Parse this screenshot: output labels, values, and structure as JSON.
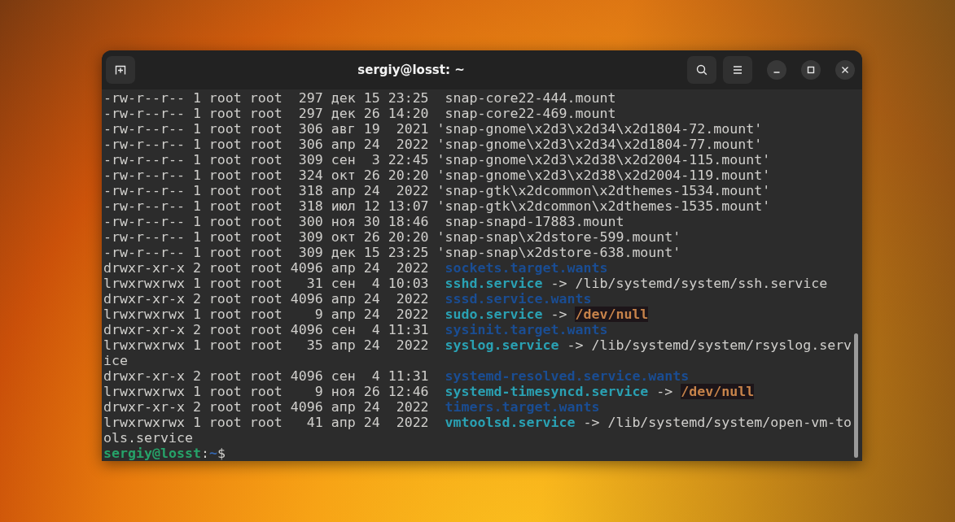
{
  "window": {
    "title": "sergiy@losst: ~"
  },
  "terminal": {
    "lines": [
      {
        "kind": "listing",
        "segments": [
          {
            "kind": "text",
            "text": "-rw-r--r-- 1 root root  297 дек 15 23:25"
          },
          {
            "kind": "text",
            "text": " snap-core22-444.mount"
          }
        ]
      },
      {
        "kind": "listing",
        "segments": [
          {
            "kind": "text",
            "text": "-rw-r--r-- 1 root root  297 дек 26 14:20"
          },
          {
            "kind": "text",
            "text": " snap-core22-469.mount"
          }
        ]
      },
      {
        "kind": "listing",
        "segments": [
          {
            "kind": "text",
            "text": "-rw-r--r-- 1 root root  306 авг 19  2021"
          },
          {
            "kind": "text",
            "text": "'snap-gnome\\x2d3\\x2d34\\x2d1804-72.mount'"
          }
        ]
      },
      {
        "kind": "listing",
        "segments": [
          {
            "kind": "text",
            "text": "-rw-r--r-- 1 root root  306 апр 24  2022"
          },
          {
            "kind": "text",
            "text": "'snap-gnome\\x2d3\\x2d34\\x2d1804-77.mount'"
          }
        ]
      },
      {
        "kind": "listing",
        "segments": [
          {
            "kind": "text",
            "text": "-rw-r--r-- 1 root root  309 сен  3 22:45"
          },
          {
            "kind": "text",
            "text": "'snap-gnome\\x2d3\\x2d38\\x2d2004-115.mount'"
          }
        ]
      },
      {
        "kind": "listing",
        "segments": [
          {
            "kind": "text",
            "text": "-rw-r--r-- 1 root root  324 окт 26 20:20"
          },
          {
            "kind": "text",
            "text": "'snap-gnome\\x2d3\\x2d38\\x2d2004-119.mount'"
          }
        ]
      },
      {
        "kind": "listing",
        "segments": [
          {
            "kind": "text",
            "text": "-rw-r--r-- 1 root root  318 апр 24  2022"
          },
          {
            "kind": "text",
            "text": "'snap-gtk\\x2dcommon\\x2dthemes-1534.mount'"
          }
        ]
      },
      {
        "kind": "listing",
        "segments": [
          {
            "kind": "text",
            "text": "-rw-r--r-- 1 root root  318 июл 12 13:07"
          },
          {
            "kind": "text",
            "text": "'snap-gtk\\x2dcommon\\x2dthemes-1535.mount'"
          }
        ]
      },
      {
        "kind": "listing",
        "segments": [
          {
            "kind": "text",
            "text": "-rw-r--r-- 1 root root  300 ноя 30 18:46"
          },
          {
            "kind": "text",
            "text": " snap-snapd-17883.mount"
          }
        ]
      },
      {
        "kind": "listing",
        "segments": [
          {
            "kind": "text",
            "text": "-rw-r--r-- 1 root root  309 окт 26 20:20"
          },
          {
            "kind": "text",
            "text": "'snap-snap\\x2dstore-599.mount'"
          }
        ]
      },
      {
        "kind": "listing",
        "segments": [
          {
            "kind": "text",
            "text": "-rw-r--r-- 1 root root  309 дек 15 23:25"
          },
          {
            "kind": "text",
            "text": "'snap-snap\\x2dstore-638.mount'"
          }
        ]
      },
      {
        "kind": "listing",
        "segments": [
          {
            "kind": "text",
            "text": "drwxr-xr-x 2 root root 4096 апр 24  2022"
          },
          {
            "kind": "dir",
            "text": " sockets.target.wants"
          }
        ]
      },
      {
        "kind": "listing",
        "segments": [
          {
            "kind": "text",
            "text": "lrwxrwxrwx 1 root root   31 сен  4 10:03"
          },
          {
            "kind": "link",
            "text": " sshd.service"
          },
          {
            "kind": "text",
            "text": "->"
          },
          {
            "kind": "text",
            "text": "/lib/systemd/system/ssh.service"
          }
        ]
      },
      {
        "kind": "listing",
        "segments": [
          {
            "kind": "text",
            "text": "drwxr-xr-x 2 root root 4096 апр 24  2022"
          },
          {
            "kind": "dir",
            "text": " sssd.service.wants"
          }
        ]
      },
      {
        "kind": "listing",
        "segments": [
          {
            "kind": "text",
            "text": "lrwxrwxrwx 1 root root    9 апр 24  2022"
          },
          {
            "kind": "link",
            "text": " sudo.service"
          },
          {
            "kind": "text",
            "text": "->"
          },
          {
            "kind": "orphan",
            "text": "/dev/null"
          }
        ]
      },
      {
        "kind": "listing",
        "segments": [
          {
            "kind": "text",
            "text": "drwxr-xr-x 2 root root 4096 сен  4 11:31"
          },
          {
            "kind": "dir",
            "text": " sysinit.target.wants"
          }
        ]
      },
      {
        "kind": "listing",
        "segments": [
          {
            "kind": "text",
            "text": "lrwxrwxrwx 1 root root   35 апр 24  2022"
          },
          {
            "kind": "link",
            "text": " syslog.service"
          },
          {
            "kind": "text",
            "text": "->"
          },
          {
            "kind": "text",
            "text": "/lib/systemd/system/rsyslog.serv"
          }
        ]
      },
      {
        "kind": "wrap",
        "segments": [
          {
            "kind": "text",
            "text": "ice"
          }
        ]
      },
      {
        "kind": "listing",
        "segments": [
          {
            "kind": "text",
            "text": "drwxr-xr-x 2 root root 4096 сен  4 11:31"
          },
          {
            "kind": "dir",
            "text": " systemd-resolved.service.wants"
          }
        ]
      },
      {
        "kind": "listing",
        "segments": [
          {
            "kind": "text",
            "text": "lrwxrwxrwx 1 root root    9 ноя 26 12:46"
          },
          {
            "kind": "link",
            "text": " systemd-timesyncd.service"
          },
          {
            "kind": "text",
            "text": "->"
          },
          {
            "kind": "orphan",
            "text": "/dev/null"
          }
        ]
      },
      {
        "kind": "listing",
        "segments": [
          {
            "kind": "text",
            "text": "drwxr-xr-x 2 root root 4096 апр 24  2022"
          },
          {
            "kind": "dir",
            "text": " timers.target.wants"
          }
        ]
      },
      {
        "kind": "listing",
        "segments": [
          {
            "kind": "text",
            "text": "lrwxrwxrwx 1 root root   41 апр 24  2022"
          },
          {
            "kind": "link",
            "text": " vmtoolsd.service"
          },
          {
            "kind": "text",
            "text": "->"
          },
          {
            "kind": "text",
            "text": "/lib/systemd/system/open-vm-to"
          }
        ]
      },
      {
        "kind": "wrap",
        "segments": [
          {
            "kind": "text",
            "text": "ols.service"
          }
        ]
      },
      {
        "kind": "prompt",
        "segments": [
          {
            "kind": "prompt_user",
            "text": "sergiy@losst"
          },
          {
            "kind": "text",
            "text": ":"
          },
          {
            "kind": "prompt_path",
            "text": "~"
          },
          {
            "kind": "text",
            "text": "$"
          }
        ]
      }
    ]
  }
}
